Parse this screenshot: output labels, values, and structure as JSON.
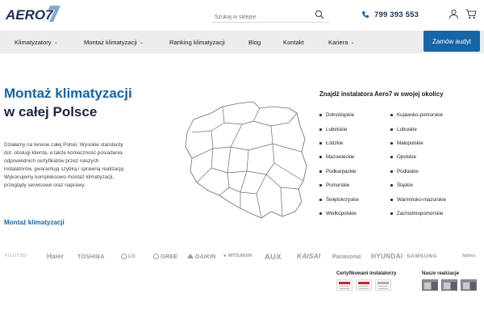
{
  "header": {
    "logo_text": "AERO7",
    "search_placeholder": "Szukaj w sklepie",
    "phone": "799 393 553"
  },
  "nav": {
    "items": [
      {
        "label": "Klimatyzatory",
        "dropdown": true
      },
      {
        "label": "Montaż klimatyzacji",
        "dropdown": true
      },
      {
        "label": "Ranking klimatyzacji",
        "dropdown": false
      },
      {
        "label": "Blog",
        "dropdown": false
      },
      {
        "label": "Kontakt",
        "dropdown": false
      },
      {
        "label": "Kariera",
        "dropdown": true
      }
    ],
    "cta": "Zamów audyt"
  },
  "hero": {
    "title_line1": "Montaż klimatyzacji",
    "title_line2": "w całej Polsce",
    "description": "Działamy na terenie całej Polski. Wysokie standardy dot. obsługi klienta, a także konieczność posiadania odpowiednich certyfikatów przez naszych instalatorów, gwarantują szybką i sprawną realizację. Wykonujemy kompleksowo montaż klimatyzacji, przeglądy serwisowe oraz naprawy.",
    "link": "Montaż klimatyzacji"
  },
  "installers": {
    "title": "Znajdź instalatora Aero7 w swojej okolicy",
    "left": [
      "Dolnośląskie",
      "Lubelskie",
      "Łódzkie",
      "Mazowieckie",
      "Podkarpackie",
      "Pomorskie",
      "Świętokrzyskie",
      "Wielkopolskie"
    ],
    "right": [
      "Kujawsko-pomorskie",
      "Lubuskie",
      "Małopolskie",
      "Opolskie",
      "Podlaskie",
      "Śląskie",
      "Warmińsko-mazurskie",
      "Zachodniopomorskie"
    ]
  },
  "brands": [
    "FUJITSU",
    "Haier",
    "TOSHIBA",
    "LG",
    "GREE",
    "DAIKIN",
    "MITSUBISHI",
    "AUX",
    "KAISAI",
    "Panasonic",
    "HYUNDAI",
    "SAMSUNG",
    "fujitsu"
  ],
  "cards": {
    "certified_title": "Certyfikowani instalatorzy",
    "realizations_title": "Nasze realizacje"
  },
  "colors": {
    "brand_blue": "#1565a8",
    "navy": "#1c2f5a",
    "nav_bg": "#ececec"
  }
}
